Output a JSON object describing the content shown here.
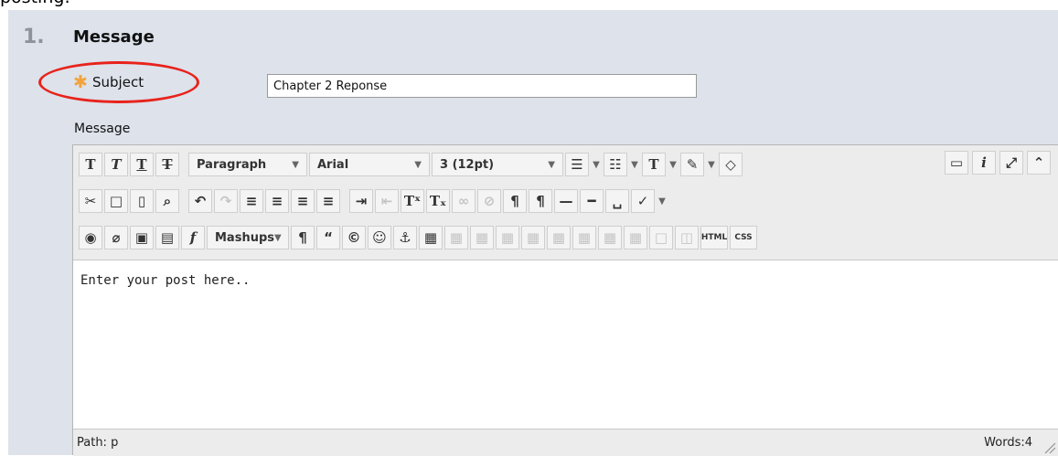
{
  "cut_text": "posting:",
  "step": {
    "number": "1.",
    "title": "Message"
  },
  "subject": {
    "required_mark": "✱",
    "label": "Subject",
    "value": "Chapter 2 Reponse"
  },
  "message_label": "Message",
  "toolbar": {
    "format_dropdown": "Paragraph",
    "font_dropdown": "Arial",
    "size_dropdown": "3 (12pt)",
    "mashups": "Mashups",
    "html_label": "HTML",
    "css_label": "CSS"
  },
  "editor": {
    "content": "Enter your post here.."
  },
  "status": {
    "path": "Path: p",
    "words": "Words:4"
  },
  "colors": {
    "panel": "#dde2eb",
    "highlight": "#e8231c",
    "required": "#f2a33a"
  }
}
